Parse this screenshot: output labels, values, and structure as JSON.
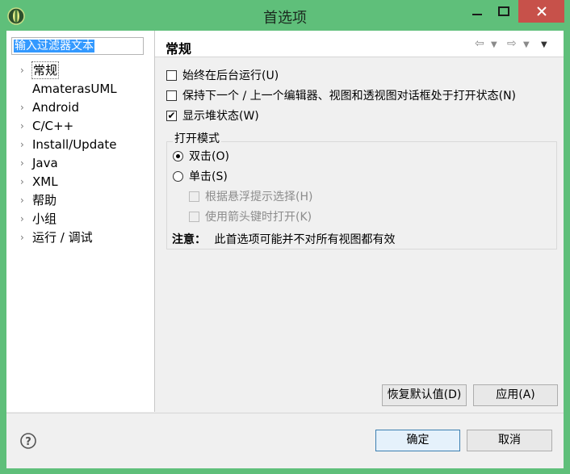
{
  "window": {
    "title": "首选项"
  },
  "filter": {
    "value": "输入过滤器文本"
  },
  "tree": [
    {
      "label": "常规",
      "expandable": true,
      "selected": true
    },
    {
      "label": "AmaterasUML",
      "expandable": false,
      "selected": false
    },
    {
      "label": "Android",
      "expandable": true,
      "selected": false
    },
    {
      "label": "C/C++",
      "expandable": true,
      "selected": false
    },
    {
      "label": "Install/Update",
      "expandable": true,
      "selected": false
    },
    {
      "label": "Java",
      "expandable": true,
      "selected": false
    },
    {
      "label": "XML",
      "expandable": true,
      "selected": false
    },
    {
      "label": "帮助",
      "expandable": true,
      "selected": false
    },
    {
      "label": "小组",
      "expandable": true,
      "selected": false
    },
    {
      "label": "运行 / 调试",
      "expandable": true,
      "selected": false
    }
  ],
  "page": {
    "title": "常规",
    "options": [
      {
        "label": "始终在后台运行(U)",
        "checked": false
      },
      {
        "label": "保持下一个 / 上一个编辑器、视图和透视图对话框处于打开状态(N)",
        "checked": false
      },
      {
        "label": "显示堆状态(W)",
        "checked": true
      }
    ],
    "open_mode": {
      "title": "打开模式",
      "double_click": "双击(O)",
      "single_click": "单击(S)",
      "selected": "double_click",
      "hover_select": "根据悬浮提示选择(H)",
      "arrow_open": "使用箭头键时打开(K)"
    },
    "note_label": "注意：",
    "note_text": "此首选项可能并不对所有视图都有效",
    "restore_defaults": "恢复默认值(D)",
    "apply": "应用(A)"
  },
  "footer": {
    "ok": "确定",
    "cancel": "取消"
  },
  "colors": {
    "frame": "#5fbf7a",
    "close": "#c7514a",
    "selection": "#3399ff"
  }
}
